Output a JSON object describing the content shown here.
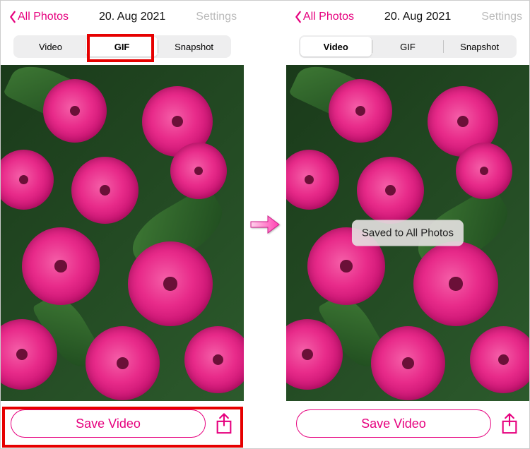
{
  "left": {
    "nav": {
      "back": "All Photos",
      "title": "20. Aug 2021",
      "settings": "Settings"
    },
    "segments": {
      "video": "Video",
      "gif": "GIF",
      "snapshot": "Snapshot",
      "selected": "gif"
    },
    "save_label": "Save Video",
    "highlight": {
      "gif": true,
      "bottom": true
    }
  },
  "right": {
    "nav": {
      "back": "All Photos",
      "title": "20. Aug 2021",
      "settings": "Settings"
    },
    "segments": {
      "video": "Video",
      "gif": "GIF",
      "snapshot": "Snapshot",
      "selected": "video"
    },
    "toast": "Saved to All Photos",
    "save_label": "Save Video"
  },
  "colors": {
    "accent": "#E6007E",
    "highlight": "#e60000"
  }
}
